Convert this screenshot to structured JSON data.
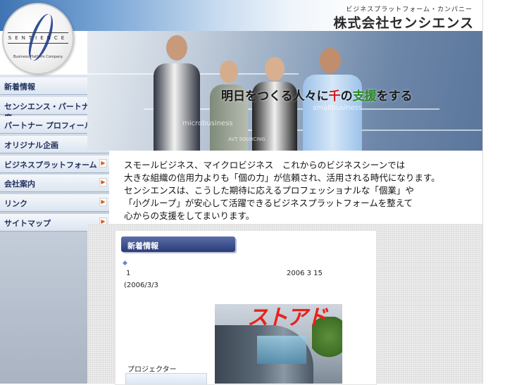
{
  "header": {
    "tagline": "ビジネスプラットフォーム・カンパニー",
    "company_name": "株式会社センシエンス",
    "logo_text": "SENTIENCE",
    "logo_subtext": "Business Platform Company"
  },
  "sidebar": {
    "items": [
      {
        "label": "新着情報"
      },
      {
        "label": "センシエンス・パートナー制度"
      },
      {
        "label": "パートナー プロフィール"
      },
      {
        "label": "オリジナル企画"
      },
      {
        "label": "ビジネスプラットフォーム"
      },
      {
        "label": "会社案内"
      },
      {
        "label": "リンク"
      },
      {
        "label": "サイトマップ"
      }
    ],
    "arrow_glyph": "▶"
  },
  "hero": {
    "slogan_pre": "明日をつくる人々に",
    "slogan_red": "千",
    "slogan_mid": "の",
    "slogan_green": "支援",
    "slogan_post": "をする",
    "watermark_1": "microbusiness",
    "watermark_2": "smallbusiness",
    "watermark_3": "AVT SOURCING"
  },
  "intro": {
    "lines": [
      "スモールビジネス、マイクロビジネス　これからのビジネスシーンでは",
      "大きな組織の信用力よりも「個の力」が信頼され、活用される時代になります。",
      "センシエンスは、こうした期待に応えるプロフェッショナルな「個業」や",
      "「小グループ」が安心して活躍できるビジネスプラットフォームを整えて",
      "心からの支援をしてまいります。"
    ]
  },
  "news": {
    "heading": "新着情報",
    "bullet": "◆",
    "item_number": "1",
    "item_date": "2006 3 15",
    "item_date2": "(2006/3/3",
    "store_sign": "ストアド",
    "projector_label": "プロジェクター"
  },
  "colors": {
    "nav_text": "#1f2f5a",
    "arrow": "#e0561a",
    "heading_bg": "#2a3b78",
    "slogan_red": "#d0171a",
    "slogan_green": "#2a8a1e"
  }
}
